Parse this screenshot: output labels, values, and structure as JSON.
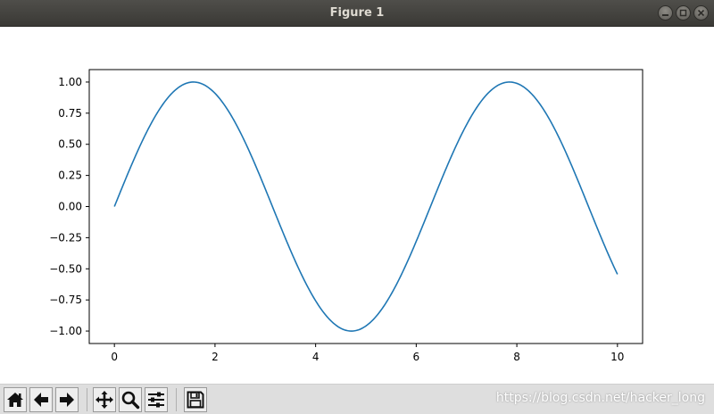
{
  "window": {
    "title": "Figure 1",
    "controls": [
      "minimize-icon",
      "maximize-icon",
      "close-icon"
    ]
  },
  "chart_data": {
    "type": "line",
    "title": "",
    "xlabel": "",
    "ylabel": "",
    "xlim": [
      -0.5,
      10.5
    ],
    "ylim": [
      -1.1,
      1.1
    ],
    "grid": false,
    "x_ticks": [
      0,
      2,
      4,
      6,
      8,
      10
    ],
    "x_tick_labels": [
      "0",
      "2",
      "4",
      "6",
      "8",
      "10"
    ],
    "y_ticks": [
      1.0,
      0.75,
      0.5,
      0.25,
      0.0,
      -0.25,
      -0.5,
      -0.75,
      -1.0
    ],
    "y_tick_labels": [
      "1.00",
      "0.75",
      "0.50",
      "0.25",
      "0.00",
      "−0.25",
      "−0.50",
      "−0.75",
      "−1.00"
    ],
    "line_color": "#1f77b4",
    "series": [
      {
        "x": [
          0,
          0.5,
          1,
          1.5,
          1.5708,
          2,
          2.5,
          3,
          3.5,
          4,
          4.5,
          4.7124,
          5,
          5.5,
          6,
          6.5,
          7,
          7.5,
          7.854,
          8,
          8.5,
          9,
          9.5,
          10
        ],
        "y": [
          0,
          0.479,
          0.841,
          0.997,
          1.0,
          0.909,
          0.598,
          0.141,
          -0.351,
          -0.757,
          -0.978,
          -1.0,
          -0.959,
          -0.706,
          -0.279,
          0.215,
          0.657,
          0.938,
          1.0,
          0.989,
          0.798,
          0.412,
          -0.075,
          -0.544
        ]
      }
    ]
  },
  "toolbar": {
    "buttons": [
      {
        "name": "home-button",
        "icon": "home-icon"
      },
      {
        "name": "back-button",
        "icon": "arrow-left-icon"
      },
      {
        "name": "forward-button",
        "icon": "arrow-right-icon"
      },
      {
        "name": "pan-button",
        "icon": "move-icon"
      },
      {
        "name": "zoom-button",
        "icon": "magnifier-icon"
      },
      {
        "name": "subplots-button",
        "icon": "sliders-icon"
      },
      {
        "name": "save-button",
        "icon": "floppy-disk-icon"
      }
    ],
    "watermark": "https://blog.csdn.net/hacker_long"
  }
}
